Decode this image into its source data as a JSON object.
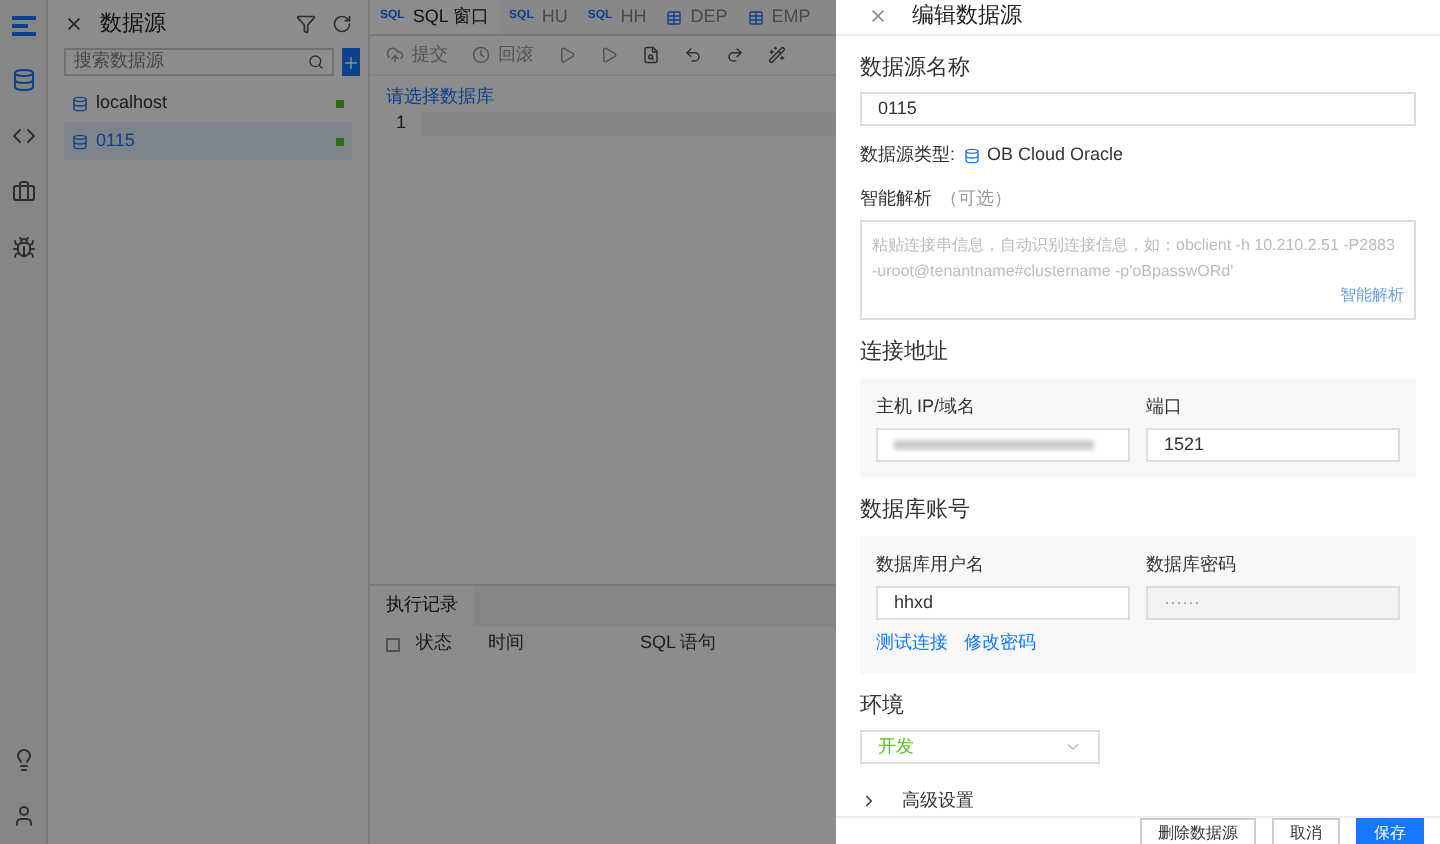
{
  "datasource_panel": {
    "title": "数据源",
    "search": {
      "placeholder": "搜索数据源"
    },
    "items": [
      {
        "name": "localhost",
        "selected": false
      },
      {
        "name": "0115",
        "selected": true
      }
    ]
  },
  "editor": {
    "tabs": [
      {
        "kind": "sql",
        "badge": "SQL",
        "label": "SQL 窗口",
        "selected": true
      },
      {
        "kind": "sql",
        "badge": "SQL",
        "label": "HU",
        "selected": false
      },
      {
        "kind": "sql",
        "badge": "SQL",
        "label": "HH",
        "selected": false
      },
      {
        "kind": "table",
        "label": "DEP",
        "selected": false
      },
      {
        "kind": "table",
        "label": "EMP",
        "selected": false
      }
    ],
    "toolbar": [
      "提交",
      "回滚"
    ],
    "database_link": "请选择数据库",
    "line_numbers": [
      "1"
    ],
    "log": {
      "title": "执行记录",
      "select_all_checked": false,
      "columns": [
        "状态",
        "时间",
        "SQL 语句"
      ]
    }
  },
  "drawer": {
    "title": "编辑数据源",
    "name_label": "数据源名称",
    "name_value": "0115",
    "type_label": "数据源类型:",
    "type_value": "OB Cloud Oracle",
    "parse_label": "智能解析",
    "parse_optional": "（可选）",
    "parse_placeholder": "粘贴连接串信息，自动识别连接信息，如：obclient -h 10.210.2.51 -P2883 -uroot@tenantname#clustername -p'oBpasswORd'",
    "parse_button": "智能解析",
    "address_label": "连接地址",
    "host_label": "主机 IP/域名",
    "port_label": "端口",
    "port_value": "1521",
    "account_label": "数据库账号",
    "user_label": "数据库用户名",
    "user_value": "hhxd",
    "password_label": "数据库密码",
    "password_value": "······",
    "links": [
      "测试连接",
      "修改密码"
    ],
    "env_label": "环境",
    "env_value": "开发",
    "advanced": {
      "label": "高级设置",
      "expanded": false
    },
    "footer": [
      {
        "label": "删除数据源",
        "primary": false
      },
      {
        "label": "取消",
        "primary": false
      },
      {
        "label": "保存",
        "primary": true
      }
    ]
  }
}
